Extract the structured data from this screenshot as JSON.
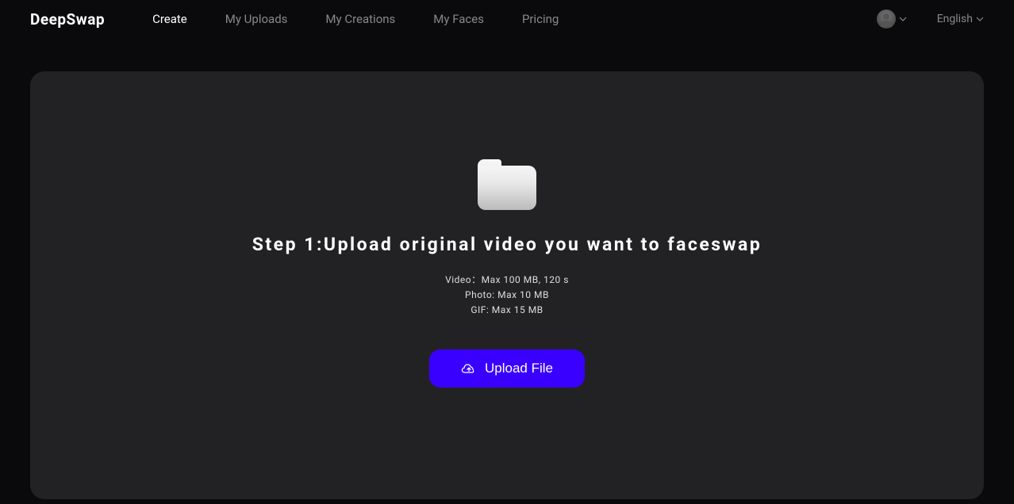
{
  "header": {
    "logo": "DeepSwap",
    "nav": [
      {
        "label": "Create",
        "active": true
      },
      {
        "label": "My Uploads",
        "active": false
      },
      {
        "label": "My Creations",
        "active": false
      },
      {
        "label": "My Faces",
        "active": false
      },
      {
        "label": "Pricing",
        "active": false
      }
    ],
    "language": "English"
  },
  "main": {
    "step_title": "Step 1:Upload original video you want to faceswap",
    "limits": {
      "video": "Video：Max 100 MB, 120 s",
      "photo": "Photo: Max 10 MB",
      "gif": "GIF: Max 15 MB"
    },
    "upload_button": "Upload File"
  }
}
